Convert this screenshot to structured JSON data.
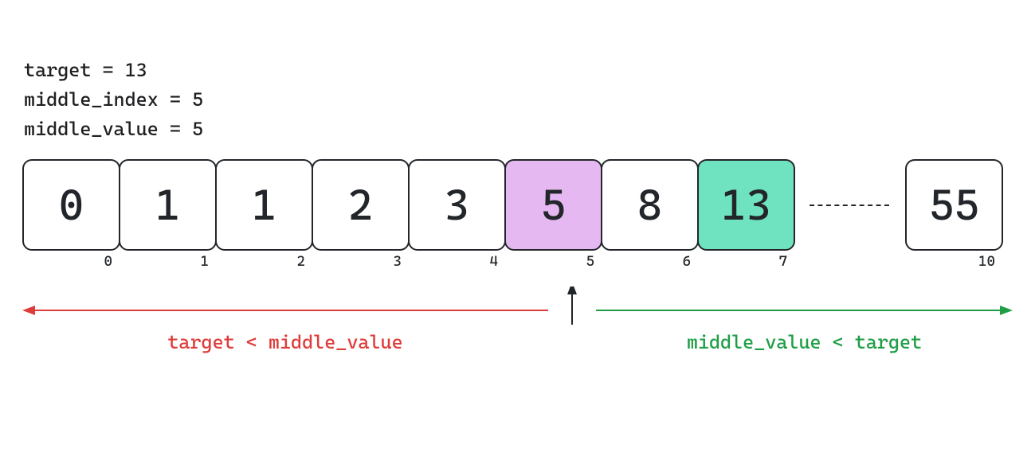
{
  "info": {
    "target_line": "target = 13",
    "middle_index_line": "middle_index = 5",
    "middle_value_line": "middle_value = 5"
  },
  "cells": [
    {
      "value": "0",
      "index": "0",
      "kind": "plain"
    },
    {
      "value": "1",
      "index": "1",
      "kind": "plain"
    },
    {
      "value": "1",
      "index": "2",
      "kind": "plain"
    },
    {
      "value": "2",
      "index": "3",
      "kind": "plain"
    },
    {
      "value": "3",
      "index": "4",
      "kind": "plain"
    },
    {
      "value": "5",
      "index": "5",
      "kind": "middle"
    },
    {
      "value": "8",
      "index": "6",
      "kind": "plain"
    },
    {
      "value": "13",
      "index": "7",
      "kind": "target"
    },
    {
      "value": "",
      "index": "",
      "kind": "gap"
    },
    {
      "value": "55",
      "index": "10",
      "kind": "plain"
    }
  ],
  "labels": {
    "left": "target < middle_value",
    "right": "middle_value < target"
  },
  "colors": {
    "middle": "#e6b8f2",
    "target": "#6fe3c0",
    "left_arrow": "#de3c3a",
    "right_arrow": "#1f9e46",
    "center_arrow": "#22262a"
  },
  "chart_data": {
    "type": "table",
    "title": "Binary search step visualization",
    "array_values": [
      0,
      1,
      1,
      2,
      3,
      5,
      8,
      13,
      null,
      null,
      55
    ],
    "indices_shown": [
      0,
      1,
      2,
      3,
      4,
      5,
      6,
      7,
      10
    ],
    "target": 13,
    "middle_index": 5,
    "middle_value": 5,
    "highlight": {
      "middle_index": 5,
      "target_index": 7
    },
    "annotations": {
      "left_side": "target < middle_value",
      "right_side": "middle_value < target"
    }
  }
}
